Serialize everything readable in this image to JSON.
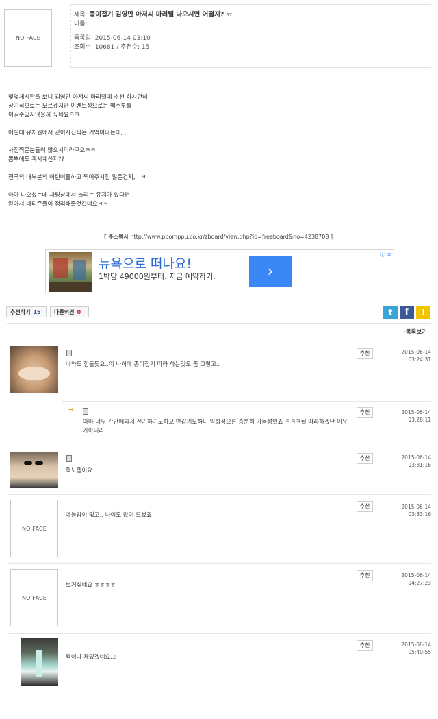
{
  "post": {
    "title_prefix": "제목:",
    "title": "종이접기 김영만 아저씨 마리텔 나오시면 어떨지?",
    "comment_count": "37",
    "name_label": "이름:",
    "date_line": "등록일: 2015-06-14 03:10",
    "stats_line": "조회수: 10681 / 추천수: 15",
    "avatar_text": "NO FACE",
    "body": [
      "몇몇게시판을 보니 김영만 아저씨 마리텔에 추천 하시던데",
      "장기적으로는 모르겠지만 이벤트성으로는 백주부를",
      "이길수있지않을까 싶네요ㅋㅋ",
      "",
      "어릴때 유치원에서 같이사진찍은 기억이나는데, , ,",
      "",
      "사진찍은분들이 많으시더라구요ㅋㅋ",
      "뽐뿌에도 혹시계신지??",
      "",
      "전국의 대부분의 어린이들하고 찍어주시진 않은건지, , ㅋ",
      "",
      "아마 나오셨는데 채팅창에서 놀리는 유저가 있다면",
      "알아서 네티즌들이 정리해줄것같네요ㅋㅋ"
    ],
    "address_label": "[ 주소복사",
    "address_url": "http://www.ppomppu.co.kr/zboard/view.php?id=freeboard&no=4238708 ]"
  },
  "ad": {
    "headline": "뉴욕으로 떠나요!",
    "subline": "1박당 49000원부터. 지금 예약하기.",
    "arrow": "›",
    "adchoices": "ⓘ ✕"
  },
  "actions": {
    "recommend_label": "추천하기",
    "recommend_count": "15",
    "dissent_label": "다른의견",
    "dissent_count": "0",
    "list_label": "-목록보기"
  },
  "comments": [
    {
      "text": "나와도 힘들듯요..이 나이에 종이접기 따라 하는것도 좀 그렇고..",
      "date": "2015-06-14",
      "time": "03:24:31",
      "rec": "추천"
    },
    {
      "text1": "아마 너무 간만에봐서 신기하기도하고 반갑기도하니 일회성으론 충분히 가능성있죠 ㅋㅋㅋ될 따라하겠단 이유",
      "text2": "가아니라",
      "date": "2015-06-14",
      "time": "03:28:11",
      "rec": "추천"
    },
    {
      "text": "핵노잼이요",
      "date": "2015-06-14",
      "time": "03:31:16",
      "rec": "추천"
    },
    {
      "text": "예능감이 없고.. 나이도 많이 드셨죠",
      "date": "2015-06-14",
      "time": "03:33:16",
      "rec": "추천",
      "avatar_text": "NO FACE"
    },
    {
      "text": "보거싶네요 ㅎㅎㅎㅎ",
      "date": "2015-06-14",
      "time": "04:27:23",
      "rec": "추천",
      "avatar_text": "NO FACE"
    },
    {
      "text": "꿱이나 재밌겠네요..;",
      "date": "2015-06-14",
      "time": "05:40:55",
      "rec": "추천"
    }
  ],
  "colors": {
    "accent_blue": "#3b87f5",
    "link_blue": "#2a55a8",
    "red": "#cc2222"
  }
}
